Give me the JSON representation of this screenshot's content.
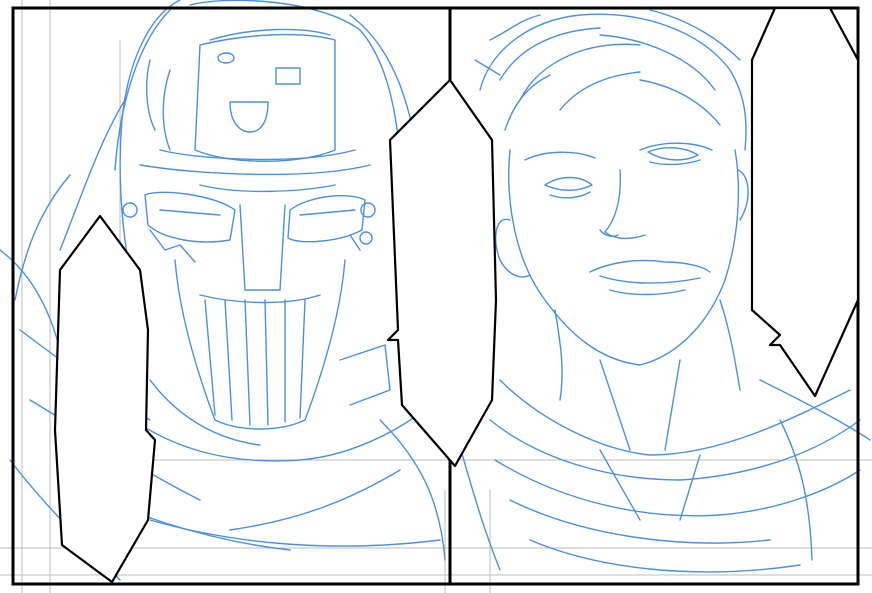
{
  "artwork": {
    "panels": [
      {
        "subject": "masked-helmeted-figure"
      },
      {
        "subject": "smiling-young-man"
      }
    ],
    "balloons": [
      {
        "panel": 1,
        "side": "left",
        "text": ""
      },
      {
        "panel": 1,
        "side": "right",
        "text": ""
      },
      {
        "panel": 2,
        "side": "right",
        "text": ""
      }
    ]
  },
  "colors": {
    "sketch": "#4a90e2",
    "guide": "#bdbdbd",
    "ink": "#000000",
    "paper": "#ffffff"
  }
}
